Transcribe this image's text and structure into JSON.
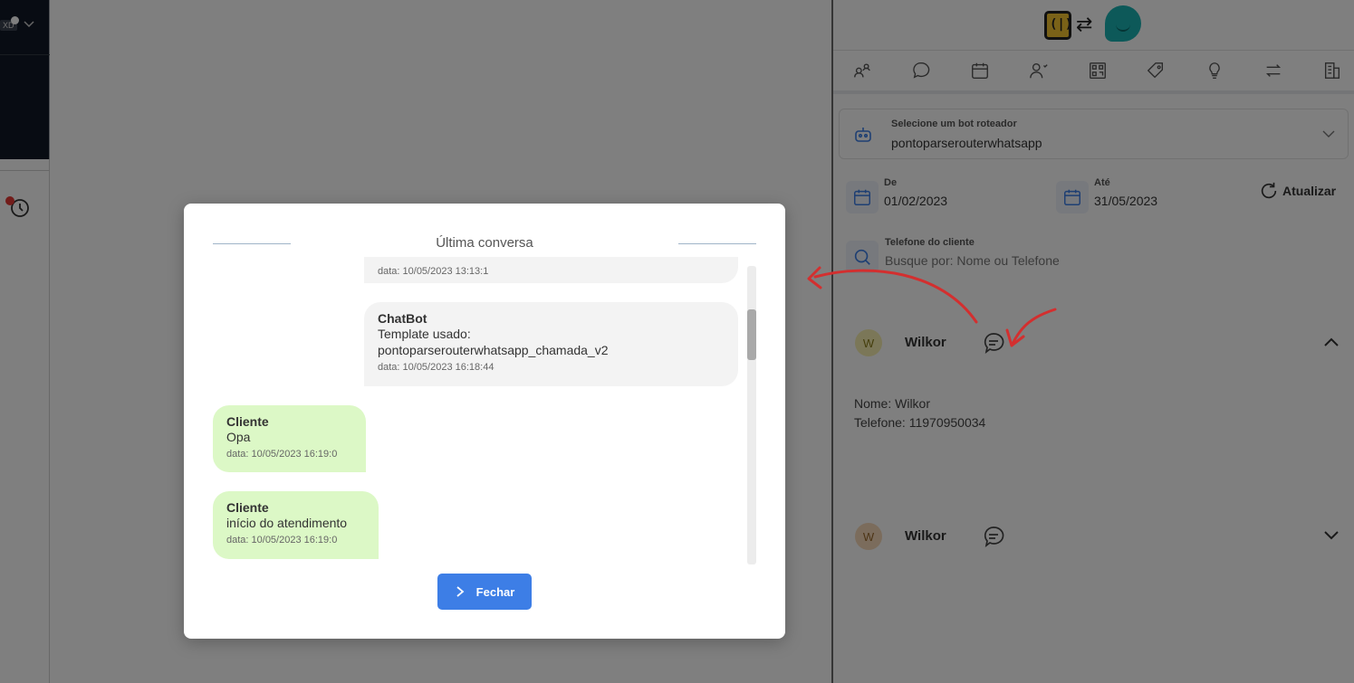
{
  "left_strip": {
    "badge": "XD"
  },
  "right_panel": {
    "tool_icons": [
      "users-icon",
      "chat-icon",
      "calendar-icon",
      "user-favorite-icon",
      "qrcode-icon",
      "tag-icon",
      "lightbulb-icon",
      "transfer-icon",
      "building-icon"
    ],
    "bot_select": {
      "label": "Selecione um bot roteador",
      "value": "pontoparserouterwhatsapp"
    },
    "date_from": {
      "label": "De",
      "value": "01/02/2023"
    },
    "date_to": {
      "label": "Até",
      "value": "31/05/2023"
    },
    "refresh_label": "Atualizar",
    "phone_search": {
      "label": "Telefone do cliente",
      "placeholder": "Busque por: Nome ou Telefone"
    },
    "contacts": [
      {
        "initial": "W",
        "name": "Wilkor",
        "expanded": true,
        "details": {
          "name_line": "Nome: Wilkor",
          "phone_line": "Telefone: 11970950034"
        }
      },
      {
        "initial": "W",
        "name": "Wilkor",
        "expanded": false
      }
    ]
  },
  "modal": {
    "title": "Última conversa",
    "messages": [
      {
        "type": "bot",
        "sender": "",
        "text": "",
        "meta": "data: 10/05/2023 13:13:1"
      },
      {
        "type": "bot",
        "sender": "ChatBot",
        "text": "Template usado: pontoparserouterwhatsapp_chamada_v2",
        "meta": "data: 10/05/2023 16:18:44"
      },
      {
        "type": "client",
        "sender": "Cliente",
        "text": "Opa",
        "meta": "data: 10/05/2023 16:19:0"
      },
      {
        "type": "client",
        "sender": "Cliente",
        "text": "início do atendimento",
        "meta": "data: 10/05/2023 16:19:0"
      }
    ],
    "close_label": "Fechar"
  },
  "colors": {
    "primary": "#3d7ee6",
    "client_bubble": "#dcf8c6",
    "bot_bubble": "#f3f3f3",
    "annotation_red": "#d32f2f"
  }
}
